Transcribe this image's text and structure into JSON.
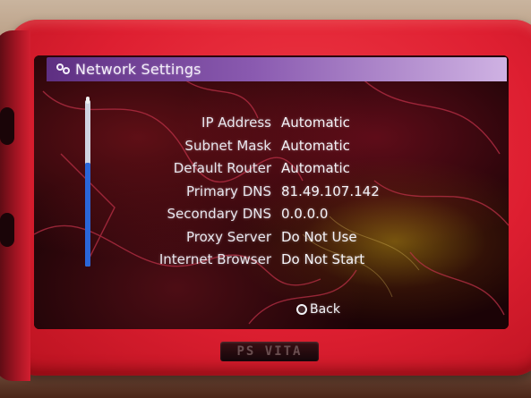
{
  "window": {
    "title": "Network Settings",
    "title_icon": "network-icon"
  },
  "settings": [
    {
      "label": "IP Address",
      "value": "Automatic"
    },
    {
      "label": "Subnet Mask",
      "value": "Automatic"
    },
    {
      "label": "Default Router",
      "value": "Automatic"
    },
    {
      "label": "Primary DNS",
      "value": "81.49.107.142"
    },
    {
      "label": "Secondary DNS",
      "value": "0.0.0.0"
    },
    {
      "label": "Proxy Server",
      "value": "Do Not Use"
    },
    {
      "label": "Internet Browser",
      "value": "Do Not Start"
    }
  ],
  "scroll": {
    "position": "bottom"
  },
  "footer": {
    "back_label": "Back",
    "back_icon": "circle-button-icon"
  },
  "device": {
    "logo_text": "PS VITA",
    "case_color": "#de1f31",
    "title_bar_colors": [
      "#5e2f82",
      "#cfb2e3"
    ],
    "scrollbar_thumb_color": "#2a66d8"
  }
}
